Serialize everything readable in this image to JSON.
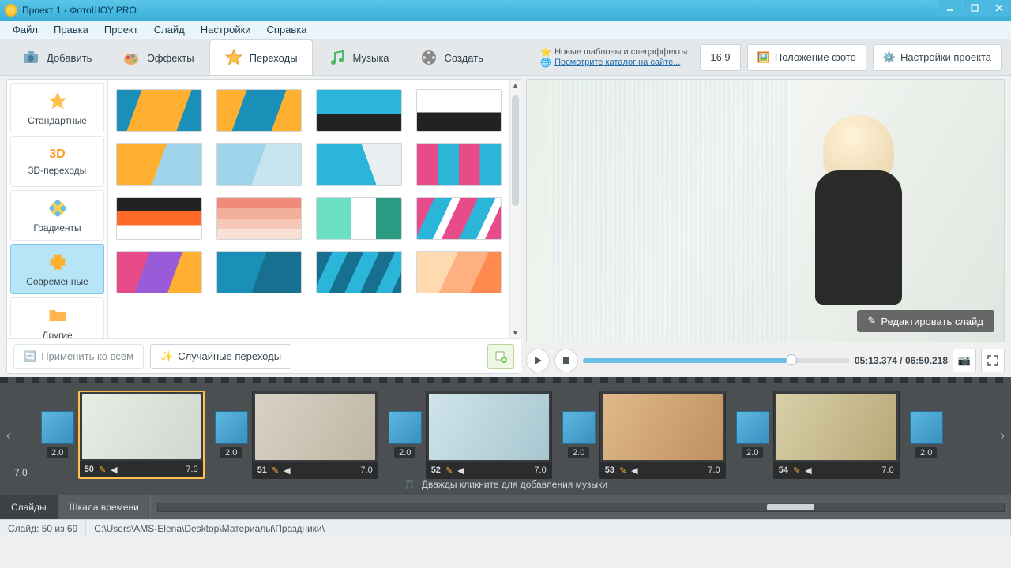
{
  "window": {
    "title": "Проект 1 - ФотоШОУ PRO"
  },
  "menu": {
    "file": "Файл",
    "edit": "Правка",
    "project": "Проект",
    "slide": "Слайд",
    "settings": "Настройки",
    "help": "Справка"
  },
  "tabs": {
    "add": "Добавить",
    "effects": "Эффекты",
    "transitions": "Переходы",
    "music": "Музыка",
    "create": "Создать"
  },
  "info": {
    "line1": "Новые шаблоны и спецэффекты",
    "line2": "Посмотрите каталог на сайте..."
  },
  "aspect": "16:9",
  "top_buttons": {
    "position": "Положение фото",
    "project_settings": "Настройки проекта"
  },
  "categories": {
    "standard": "Стандартные",
    "three_d_icon": "3D",
    "three_d": "3D-переходы",
    "gradients": "Градиенты",
    "modern": "Современные",
    "other": "Другие"
  },
  "bottom_buttons": {
    "apply_all": "Применить ко всем",
    "random": "Случайные переходы"
  },
  "preview": {
    "edit_slide": "Редактировать слайд",
    "time_current": "05:13.374",
    "time_total": "06:50.218"
  },
  "timeline": {
    "lead_duration": "7.0",
    "transition_duration": "2.0",
    "slides": [
      {
        "num": "50",
        "dur": "7.0"
      },
      {
        "num": "51",
        "dur": "7.0"
      },
      {
        "num": "52",
        "dur": "7.0"
      },
      {
        "num": "53",
        "dur": "7.0"
      },
      {
        "num": "54",
        "dur": "7.0"
      }
    ],
    "music_hint": "Дважды кликните для добавления музыки",
    "tab_slides": "Слайды",
    "tab_scale": "Шкала времени"
  },
  "status": {
    "slide": "Слайд: 50 из 69",
    "path": "C:\\Users\\AMS-Elena\\Desktop\\Материалы\\Праздники\\"
  }
}
